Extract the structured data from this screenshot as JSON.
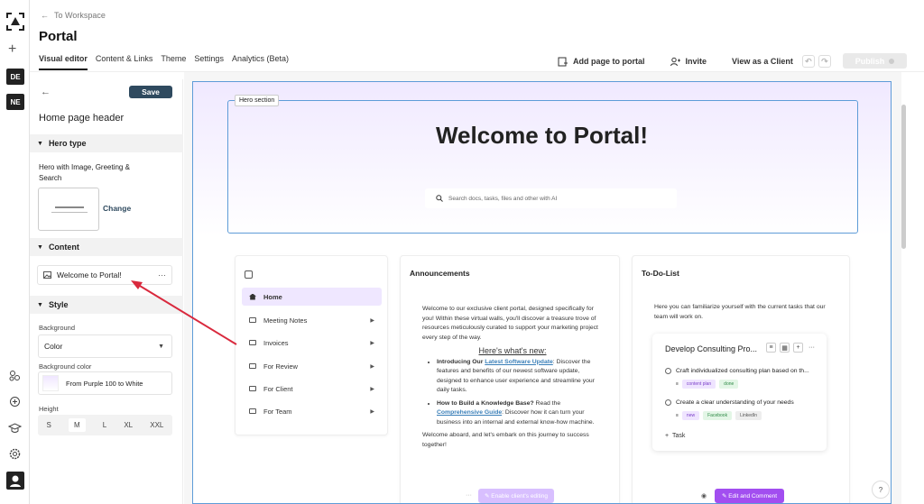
{
  "rail": {
    "workspaces": [
      "DE",
      "NE"
    ]
  },
  "topbar": {
    "back_label": "To Workspace",
    "title": "Portal",
    "tabs": [
      "Visual editor",
      "Content & Links",
      "Theme",
      "Settings",
      "Analytics (Beta)"
    ],
    "add_page": "Add page to portal",
    "invite": "Invite",
    "view_client": "View as a Client",
    "publish": "Publish"
  },
  "sidebar": {
    "save": "Save",
    "heading": "Home page header",
    "hero_type": "Hero type",
    "hero_desc": "Hero with Image, Greeting & Search",
    "change": "Change",
    "content": "Content",
    "content_item": "Welcome to Portal!",
    "style": "Style",
    "background_label": "Background",
    "background_value": "Color",
    "bgcolor_label": "Background color",
    "bgcolor_value": "From Purple 100 to White",
    "height_label": "Height",
    "sizes": [
      "S",
      "M",
      "L",
      "XL",
      "XXL"
    ],
    "active_size": "M"
  },
  "canvas": {
    "hero_tag": "Hero section",
    "hero_title": "Welcome to Portal!",
    "search_placeholder": "Search docs, tasks, files and other with AI",
    "nav": [
      "Home",
      "Meeting Notes",
      "Invoices",
      "For Review",
      "For Client",
      "For Team"
    ],
    "announcements": {
      "title": "Announcements",
      "intro": "Welcome to our exclusive client portal, designed specifically for you! Within these virtual walls, you'll discover a treasure trove of resources meticulously curated to support your marketing project every step of the way.",
      "subheading": "Here's what's new:",
      "b1_bold": "Introducing Our ",
      "b1_link": "Latest Software Update",
      "b1_text": ": Discover the features and benefits of our newest software update, designed to enhance user experience and streamline your daily tasks.",
      "b2_bold": "How to Build a Knowledge Base?",
      "b2_text1": " Read the ",
      "b2_link": "Comprehensive Guide",
      "b2_text2": ": Discover how it can turn your business into an  internal and external know-how machine.",
      "closing": "Welcome aboard, and let's embark on this journey to success together!",
      "enable": "Enable client's editing"
    },
    "todo": {
      "title": "To-Do-List",
      "intro": "Here you can familiarize yourself with the current tasks that our team will work on.",
      "task_title": "Develop Consulting Pro...",
      "item1": "Craft individualized consulting plan based on th...",
      "item1_tags": [
        "content plan",
        "done"
      ],
      "item2": "Create a clear understanding of your needs",
      "item2_tags": [
        "new",
        "Facebook",
        "LinkedIn"
      ],
      "add_task": "Task",
      "edit": "Edit and Comment"
    }
  },
  "colors": {
    "accent": "#a24ef0",
    "save": "#2f4a5f",
    "selection": "#5e9cd8",
    "arrow": "#d9293d"
  }
}
